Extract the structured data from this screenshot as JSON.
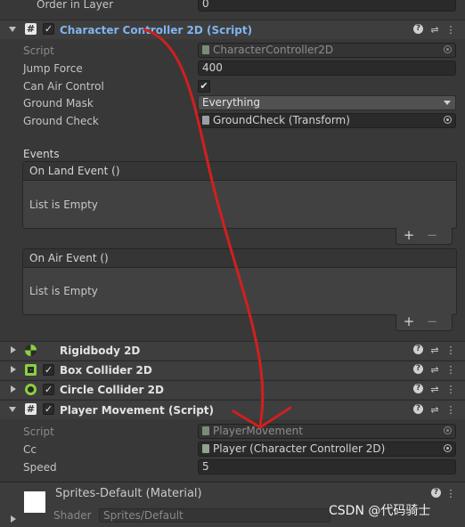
{
  "top_row": {
    "label": "Order in Layer",
    "value": "0"
  },
  "character_controller": {
    "title": "Character Controller 2D (Script)",
    "enabled": true,
    "script_label": "Script",
    "script_value": "CharacterController2D",
    "fields": [
      {
        "label": "Jump Force",
        "value": "400"
      },
      {
        "label": "Can Air Control",
        "value": "✔"
      },
      {
        "label": "Ground Mask",
        "value": "Everything"
      },
      {
        "label": "Ground Check",
        "value": "GroundCheck (Transform)"
      }
    ],
    "events_header": "Events",
    "events": [
      {
        "name": "On Land Event ()",
        "body": "List is Empty"
      },
      {
        "name": "On Air Event ()",
        "body": "List is Empty"
      }
    ],
    "plus": "+",
    "minus": "−"
  },
  "components": [
    {
      "title": "Rigidbody 2D",
      "icon_color": "#8bd03e"
    },
    {
      "title": "Box Collider 2D",
      "icon_color": "#8bd03e"
    },
    {
      "title": "Circle Collider 2D",
      "icon_color": "#8bd03e"
    },
    {
      "title": "Player Movement (Script)",
      "icon_color": "#e0e0e0"
    }
  ],
  "player_movement": {
    "fields": [
      {
        "label": "Script",
        "value": "PlayerMovement"
      },
      {
        "label": "Cc",
        "value": "Player (Character Controller 2D)"
      },
      {
        "label": "Speed",
        "value": "5"
      }
    ]
  },
  "material": {
    "title": "Sprites-Default (Material)",
    "shader_label": "Shader",
    "shader_value": "Sprites/Default"
  },
  "header_icons": {
    "help": "?",
    "settings": "⇌",
    "more": "⋮"
  },
  "watermark": "CSDN @代码骑士",
  "colors": {
    "title_link": "#7fb4f0",
    "annotation_arrow": "#d21f1f"
  }
}
